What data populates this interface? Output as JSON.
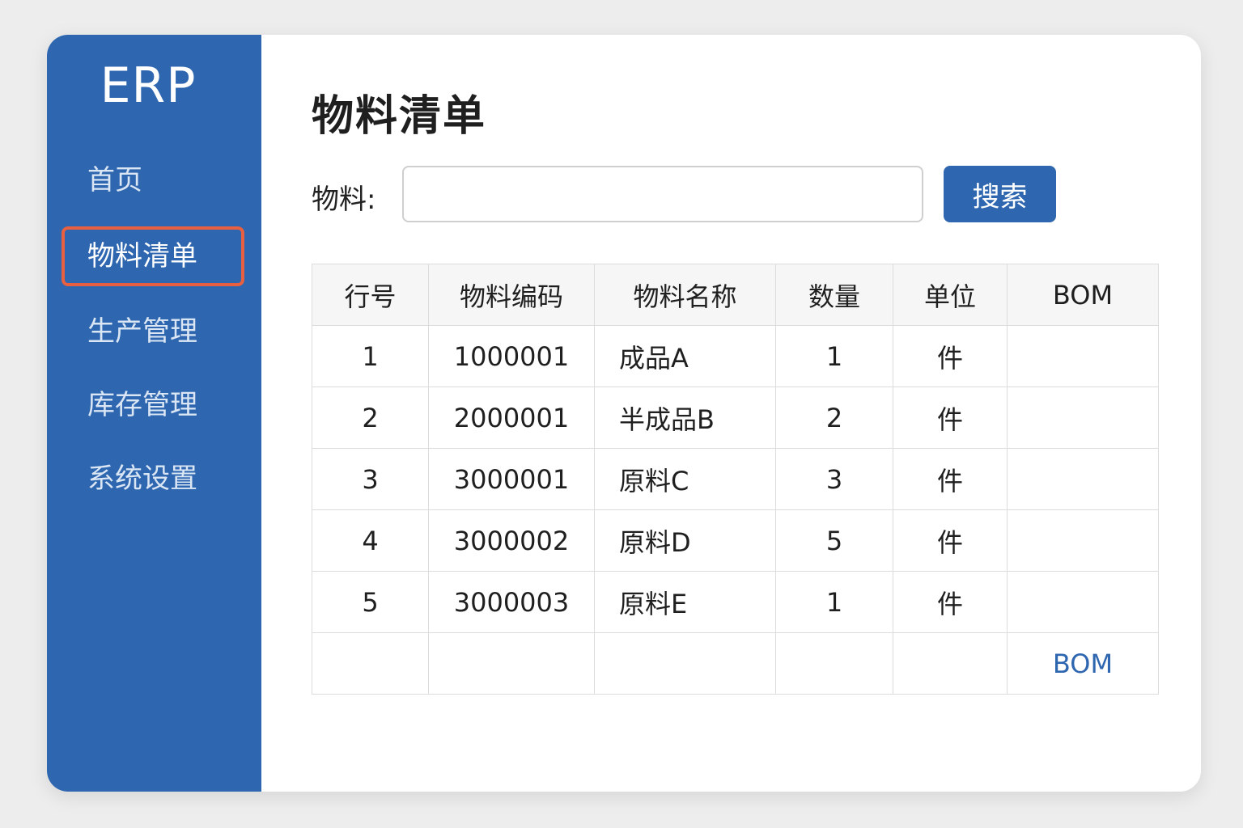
{
  "sidebar": {
    "logo": "ERP",
    "items": [
      {
        "label": "首页",
        "active": false
      },
      {
        "label": "物料清单",
        "active": true
      },
      {
        "label": "生产管理",
        "active": false
      },
      {
        "label": "库存管理",
        "active": false
      },
      {
        "label": "系统设置",
        "active": false
      }
    ],
    "active_outline_color": "#e8603f",
    "background_color": "#2e66b0"
  },
  "main": {
    "title": "物料清单",
    "search": {
      "label": "物料:",
      "value": "",
      "placeholder": "",
      "button_label": "搜索"
    },
    "table": {
      "columns": [
        "行号",
        "物料编码",
        "物料名称",
        "数量",
        "单位",
        "BOM"
      ],
      "rows": [
        [
          "1",
          "1000001",
          "成品A",
          "1",
          "件",
          ""
        ],
        [
          "2",
          "2000001",
          "半成品B",
          "2",
          "件",
          ""
        ],
        [
          "3",
          "3000001",
          "原料C",
          "3",
          "件",
          ""
        ],
        [
          "4",
          "3000002",
          "原料D",
          "5",
          "件",
          ""
        ],
        [
          "5",
          "3000003",
          "原料E",
          "1",
          "件",
          ""
        ]
      ],
      "footer_link": "BOM"
    }
  },
  "colors": {
    "accent": "#2e66b0",
    "link": "#2e66b0"
  }
}
